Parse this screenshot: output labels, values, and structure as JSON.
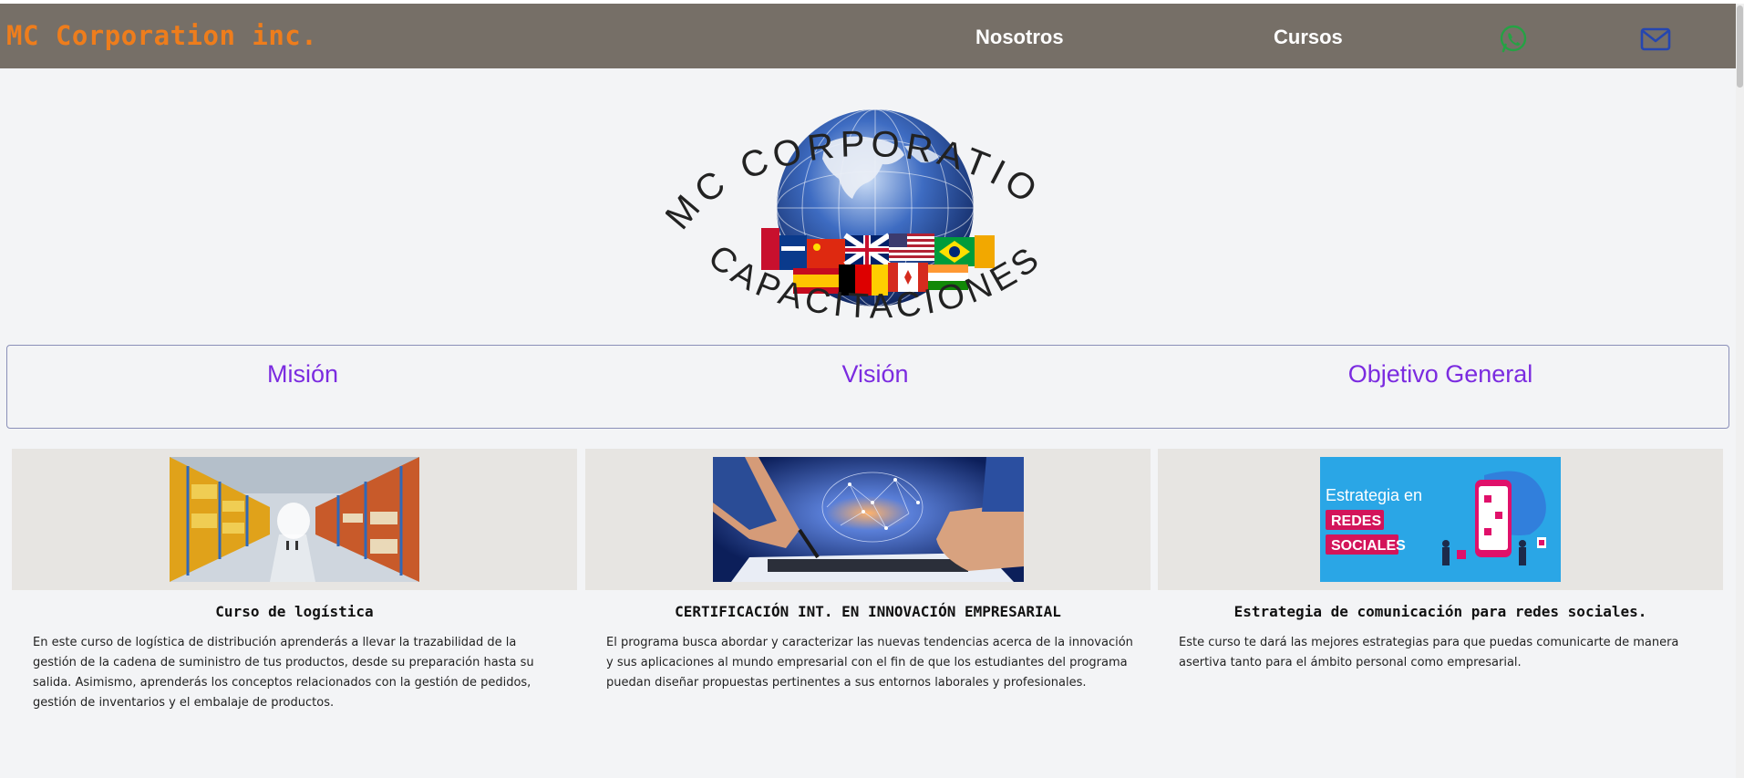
{
  "navbar": {
    "brand": "MC Corporation inc.",
    "links": [
      {
        "label": "Nosotros"
      },
      {
        "label": "Cursos"
      }
    ],
    "icons": {
      "whatsapp": "whatsapp-icon",
      "mail": "mail-icon"
    },
    "colors": {
      "background": "#766f67",
      "brand": "#ee7d1c",
      "whatsapp": "#25a244",
      "mail": "#2546b0"
    }
  },
  "logo": {
    "top_text": "MC CORPORATION",
    "bottom_text": "CAPACITACIONES"
  },
  "tabs": [
    {
      "label": "Misión"
    },
    {
      "label": "Visión"
    },
    {
      "label": "Objetivo General"
    }
  ],
  "courses": [
    {
      "title": "Curso de logística",
      "description": "En este curso de logística de distribución aprenderás a llevar la trazabilidad de la gestión de la cadena de suministro de tus productos, desde su preparación hasta su salida. Asimismo, aprenderás los conceptos relacionados con la gestión de pedidos, gestión de inventarios y el embalaje de productos."
    },
    {
      "title": "CERTIFICACIÓN INT. EN INNOVACIÓN EMPRESARIAL",
      "description": "El programa busca abordar y caracterizar las nuevas tendencias acerca de la innovación y sus aplicaciones al mundo empresarial con el fin de que los estudiantes del programa puedan diseñar propuestas pertinentes a sus entornos laborales y profesionales."
    },
    {
      "title": "Estrategia de comunicación para redes sociales.",
      "description": "Este curso te dará las mejores estrategias para que puedas comunicarte de manera asertiva tanto para el ámbito personal como empresarial.",
      "image_text": {
        "line1": "Estrategia en",
        "line2": "REDES",
        "line3": "SOCIALES"
      }
    }
  ]
}
